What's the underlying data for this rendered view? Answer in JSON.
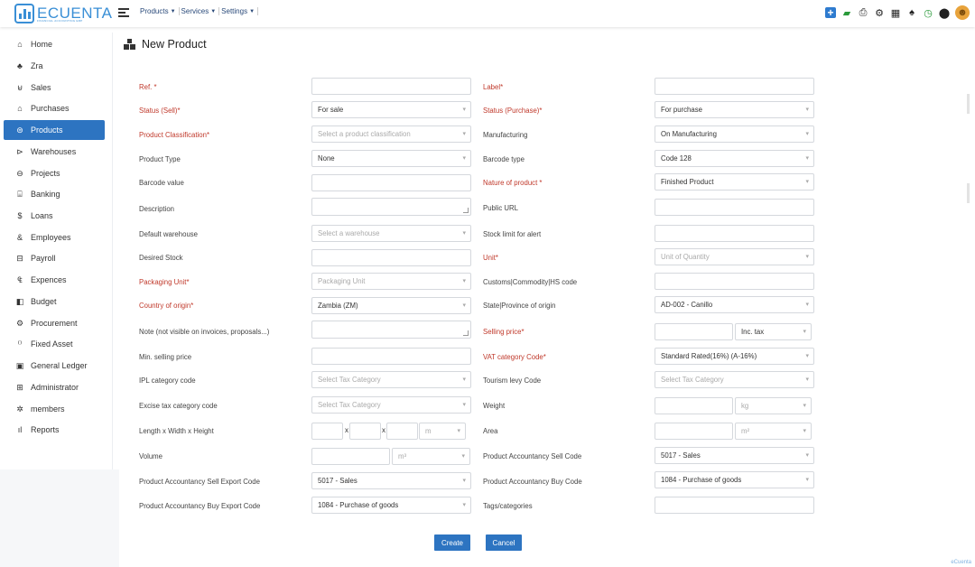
{
  "brand": {
    "name": "ECUENTA",
    "tagline": "FINANCIAL ACCOUNTING ERP"
  },
  "topmenu": [
    {
      "label": "Products"
    },
    {
      "label": "Services"
    },
    {
      "label": "Settings"
    }
  ],
  "sidebar": {
    "items": [
      {
        "label": "Home",
        "icon": "⌂"
      },
      {
        "label": "Zra",
        "icon": "♣"
      },
      {
        "label": "Sales",
        "icon": "⊌"
      },
      {
        "label": "Purchases",
        "icon": "⌂"
      },
      {
        "label": "Products",
        "icon": "⊜"
      },
      {
        "label": "Warehouses",
        "icon": "⊳"
      },
      {
        "label": "Projects",
        "icon": "⊖"
      },
      {
        "label": "Banking",
        "icon": "⌸"
      },
      {
        "label": "Loans",
        "icon": "$"
      },
      {
        "label": "Employees",
        "icon": "&"
      },
      {
        "label": "Payroll",
        "icon": "⊟"
      },
      {
        "label": "Expences",
        "icon": "₠"
      },
      {
        "label": "Budget",
        "icon": "◧"
      },
      {
        "label": "Procurement",
        "icon": "⚙"
      },
      {
        "label": "Fixed Asset",
        "icon": "⁽⁾"
      },
      {
        "label": "General Ledger",
        "icon": "▣"
      },
      {
        "label": "Administrator",
        "icon": "⊞"
      },
      {
        "label": "members",
        "icon": "✲"
      },
      {
        "label": "Reports",
        "icon": "ıl"
      }
    ]
  },
  "page": {
    "title": "New Product"
  },
  "form": {
    "ref_label": "Ref. *",
    "label_label": "Label*",
    "status_sell_label": "Status (Sell)*",
    "status_sell_value": "For sale",
    "status_purchase_label": "Status (Purchase)*",
    "status_purchase_value": "For purchase",
    "classification_label": "Product Classification*",
    "classification_placeholder": "Select a product classification",
    "manufacturing_label": "Manufacturing",
    "manufacturing_value": "On Manufacturing",
    "product_type_label": "Product Type",
    "product_type_value": "None",
    "barcode_type_label": "Barcode type",
    "barcode_type_value": "Code 128",
    "barcode_value_label": "Barcode value",
    "nature_label": "Nature of product *",
    "nature_value": "Finished Product",
    "description_label": "Description",
    "public_url_label": "Public URL",
    "default_warehouse_label": "Default warehouse",
    "default_warehouse_placeholder": "Select a warehouse",
    "stock_limit_label": "Stock limit for alert",
    "desired_stock_label": "Desired Stock",
    "unit_label": "Unit*",
    "unit_placeholder": "Unit of Quantity",
    "packaging_unit_label": "Packaging Unit*",
    "packaging_unit_placeholder": "Packaging Unit",
    "customs_label": "Customs|Commodity|HS code",
    "country_label": "Country of origin*",
    "country_value": "Zambia (ZM)",
    "state_label": "State|Province of origin",
    "state_value": "AD-002 - Canillo",
    "note_label": "Note (not visible on invoices, proposals...)",
    "selling_price_label": "Selling price*",
    "selling_price_tax": "Inc. tax",
    "min_selling_label": "Min. selling price",
    "vat_label": "VAT category Code*",
    "vat_value": "Standard Rated(16%) (A-16%)",
    "ipl_label": "IPL category code",
    "ipl_placeholder": "Select Tax Category",
    "tourism_label": "Tourism levy Code",
    "tourism_placeholder": "Select Tax Category",
    "excise_label": "Excise tax category code",
    "excise_placeholder": "Select Tax Category",
    "weight_label": "Weight",
    "weight_unit": "kg",
    "lwh_label": "Length x Width x Height",
    "lwh_sep1": "x",
    "lwh_sep2": "x",
    "lwh_unit": "m",
    "area_label": "Area",
    "area_unit": "m²",
    "volume_label": "Volume",
    "volume_unit": "m³",
    "sell_code_label": "Product Accountancy Sell Code",
    "sell_code_value": "5017 - Sales",
    "sell_export_label": "Product Accountancy Sell Export Code",
    "sell_export_value": "5017 - Sales",
    "buy_code_label": "Product Accountancy Buy Code",
    "buy_code_value": "1084 - Purchase of goods",
    "buy_export_label": "Product Accountancy Buy Export Code",
    "buy_export_value": "1084 - Purchase of goods",
    "tags_label": "Tags/categories"
  },
  "actions": {
    "create": "Create",
    "cancel": "Cancel"
  },
  "footer": {
    "brand": "eCuenta"
  },
  "colors": {
    "primary": "#2d74c1",
    "required": "#c0392b",
    "brand": "#3a8fd6"
  }
}
